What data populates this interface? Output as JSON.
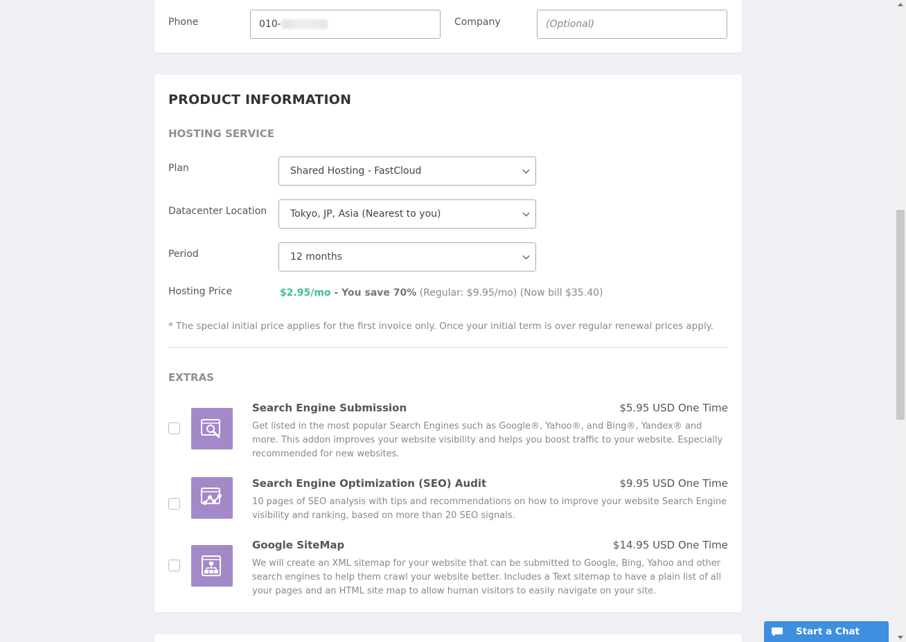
{
  "contact": {
    "phone_label": "Phone",
    "phone_value": "010-",
    "company_label": "Company",
    "company_placeholder": "(Optional)"
  },
  "product": {
    "title": "PRODUCT INFORMATION",
    "hosting_title": "HOSTING SERVICE",
    "plan_label": "Plan",
    "plan_value": "Shared Hosting - FastCloud",
    "datacenter_label": "Datacenter Location",
    "datacenter_value": "Tokyo, JP, Asia (Nearest to you)",
    "period_label": "Period",
    "period_value": "12 months",
    "price_label": "Hosting Price",
    "price_monthly": "$2.95/mo",
    "price_save": " - You save 70%",
    "price_rest": " (Regular: $9.95/mo) (Now bill $35.40)",
    "note": "* The special initial price applies for the first invoice only. Once your initial term is over regular renewal prices apply."
  },
  "extras": {
    "title": "EXTRAS",
    "items": [
      {
        "title": "Search Engine Submission",
        "price": "$5.95 USD One Time",
        "desc": "Get listed in the most popular Search Engines such as Google®, Yahoo®, and Bing®, Yandex® and more. This addon improves your website visibility and helps you boost traffic to your website. Especially recommended for new websites.",
        "icon": "search-magnifier-icon"
      },
      {
        "title": "Search Engine Optimization (SEO) Audit",
        "price": "$9.95 USD One Time",
        "desc": "10 pages of SEO analysis with tips and recommendations on how to improve your website Search Engine visibility and ranking, based on more than 20 SEO signals.",
        "icon": "seo-graph-icon"
      },
      {
        "title": "Google SiteMap",
        "price": "$14.95 USD One Time",
        "desc": "We will create an XML sitemap for your website that can be submitted to Google, Bing, Yahoo and other search engines to help them crawl your website better. Includes a Text sitemap to have a plain list of all your pages and an HTML site map to allow human visitors to easily navigate on your site.",
        "icon": "sitemap-icon"
      }
    ]
  },
  "chat": {
    "label": "Start a Chat"
  },
  "colors": {
    "accent_green": "#3fbf8a",
    "icon_purple": "#a389c8",
    "chat_blue": "#3d8fe0"
  }
}
